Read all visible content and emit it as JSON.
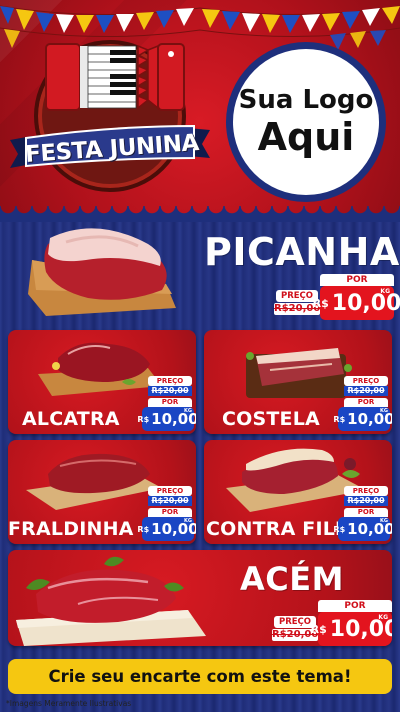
{
  "header": {
    "festa_title": "FESTA JUNINA",
    "logo_line1": "Sua Logo",
    "logo_line2": "Aqui"
  },
  "colors": {
    "red": "#c8131c",
    "blue_wood": "#22338a",
    "price_red": "#e3141e",
    "price_blue": "#1a46c4",
    "cta_yellow": "#f5c711"
  },
  "products": {
    "picanha": {
      "name": "PICANHA",
      "preco_label": "PREÇO",
      "old_price": "R$20,00",
      "por_label": "POR",
      "currency": "R$",
      "price": "10,00",
      "unit": "KG"
    },
    "alcatra": {
      "name": "ALCATRA",
      "preco_label": "PREÇO",
      "old_price": "R$20,00",
      "por_label": "POR",
      "currency": "R$",
      "price": "10,00",
      "unit": "KG"
    },
    "costela": {
      "name": "COSTELA",
      "preco_label": "PREÇO",
      "old_price": "R$20,00",
      "por_label": "POR",
      "currency": "R$",
      "price": "10,00",
      "unit": "KG"
    },
    "fraldinha": {
      "name": "FRALDINHA",
      "preco_label": "PREÇO",
      "old_price": "R$20,00",
      "por_label": "POR",
      "currency": "R$",
      "price": "10,00",
      "unit": "KG"
    },
    "contra_file": {
      "name": "CONTRA FILÉ",
      "preco_label": "PREÇO",
      "old_price": "R$20,00",
      "por_label": "POR",
      "currency": "R$",
      "price": "10,00",
      "unit": "KG"
    },
    "acem": {
      "name": "ACÉM",
      "preco_label": "PREÇO",
      "old_price": "R$20,00",
      "por_label": "POR",
      "currency": "R$",
      "price": "10,00",
      "unit": "KG"
    }
  },
  "cta": {
    "label": "Crie seu encarte com este tema!"
  },
  "footnote": "*Imagens Meramente Ilustrativas",
  "icons": [
    "accordion-icon",
    "meat-icon",
    "cutting-board-icon",
    "bunting-icon"
  ]
}
